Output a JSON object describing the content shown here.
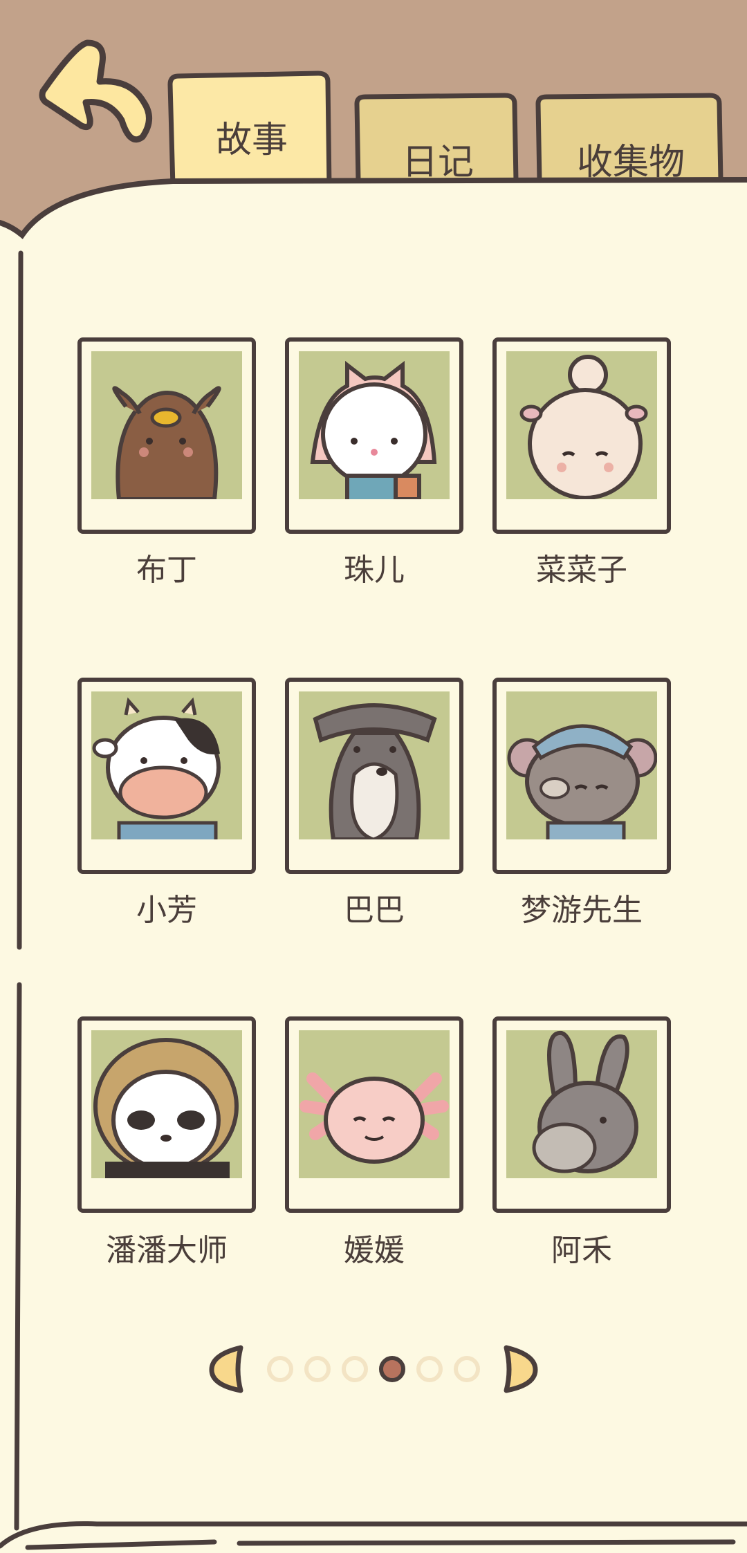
{
  "tabs": [
    {
      "label": "故事",
      "active": true
    },
    {
      "label": "日记",
      "active": false
    },
    {
      "label": "收集物",
      "active": false
    }
  ],
  "characters": [
    {
      "name": "布丁",
      "icon": "puppy-portrait"
    },
    {
      "name": "珠儿",
      "icon": "cat-portrait"
    },
    {
      "name": "菜菜子",
      "icon": "sheep-portrait"
    },
    {
      "name": "小芳",
      "icon": "cow-portrait"
    },
    {
      "name": "巴巴",
      "icon": "schnauzer-portrait"
    },
    {
      "name": "梦游先生",
      "icon": "mouse-portrait"
    },
    {
      "name": "潘潘大师",
      "icon": "panda-portrait"
    },
    {
      "name": "媛媛",
      "icon": "axolotl-portrait"
    },
    {
      "name": "阿禾",
      "icon": "donkey-portrait"
    }
  ],
  "pagination": {
    "pages": 6,
    "current": 4
  },
  "colors": {
    "background": "#c2a28a",
    "paper": "#fdf9e2",
    "outline": "#4a3e3c",
    "tab_active": "#fce8a6",
    "tab_inactive": "#e6d18f",
    "portrait_bg": "#c4c991",
    "dot_active": "#b8735e",
    "dot_inactive": "#f3e4c4"
  }
}
